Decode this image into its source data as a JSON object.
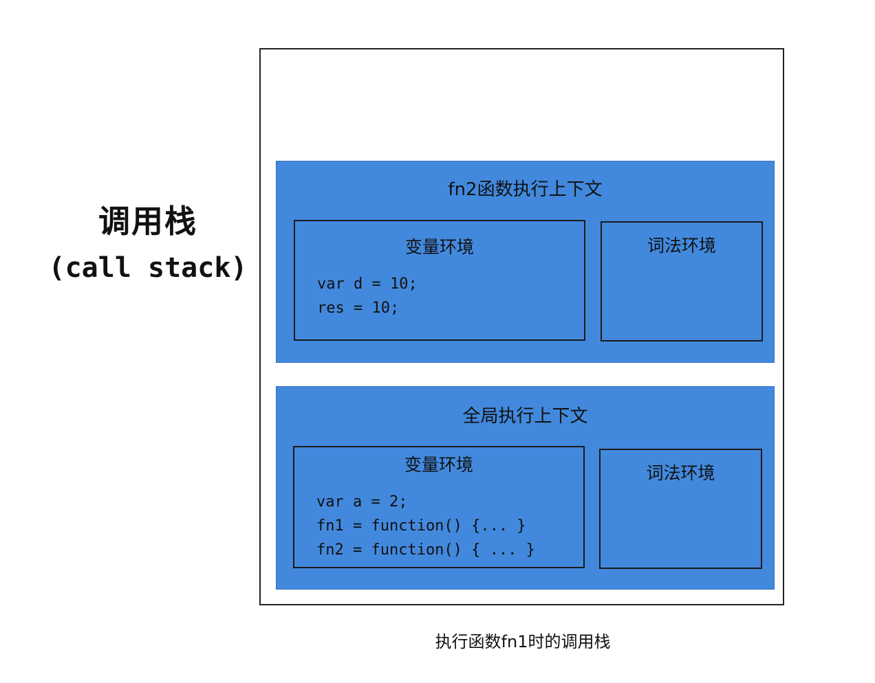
{
  "side_label": {
    "title": "调用栈",
    "subtitle": "(call stack)"
  },
  "contexts": [
    {
      "title": "fn2函数执行上下文",
      "variable_env": {
        "title": "变量环境",
        "lines": [
          "var d = 10;",
          "res = 10;"
        ]
      },
      "lexical_env": {
        "title": "词法环境"
      }
    },
    {
      "title": "全局执行上下文",
      "variable_env": {
        "title": "变量环境",
        "lines": [
          "var a = 2;",
          "fn1 = function() {... }",
          "fn2 = function() { ... }"
        ]
      },
      "lexical_env": {
        "title": "词法环境"
      }
    }
  ],
  "caption": "执行函数fn1时的调用栈",
  "colors": {
    "context_fill": "#4289dd",
    "border": "#1a1a1a"
  }
}
